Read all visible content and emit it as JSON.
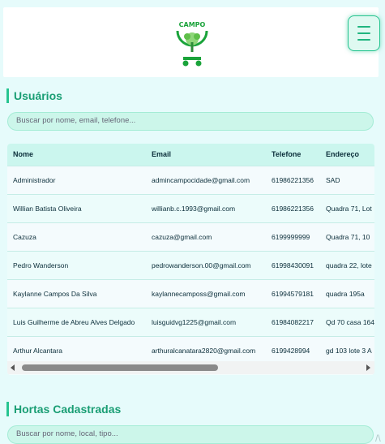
{
  "header": {
    "logo_label": "Campo",
    "menu_icon": "hamburger-icon"
  },
  "users": {
    "title": "Usuários",
    "search_placeholder": "Buscar por nome, email, telefone...",
    "columns": [
      "Nome",
      "Email",
      "Telefone",
      "Endereço"
    ],
    "rows": [
      [
        "Administrador",
        "admincampocidade@gmail.com",
        "61986221356",
        "SAD"
      ],
      [
        "Willian Batista Oliveira",
        "willianb.c.1993@gmail.com",
        "61986221356",
        "Quadra 71, Lot"
      ],
      [
        "Cazuza",
        "cazuza@gmail.com",
        "6199999999",
        "Quadra 71, 10"
      ],
      [
        "Pedro Wanderson",
        "pedrowanderson.00@gmail.com",
        "61998430091",
        "quadra 22, lote"
      ],
      [
        "Kaylanne Campos Da Silva",
        "kaylannecamposs@gmail.com",
        "61994579181",
        "quadra 195a"
      ],
      [
        "Luis Guilherme de Abreu Alves Delgado",
        "luisguidvg1225@gmail.com",
        "61984082217",
        "Qd 70 casa 164"
      ],
      [
        "Arthur Alcantara",
        "arthuralcanatara2820@gmail.com",
        "6199428994",
        "gd 103 lote 3 A"
      ]
    ]
  },
  "hortas": {
    "title": "Hortas Cadastradas",
    "search_placeholder": "Buscar por nome, local, tipo..."
  },
  "colors": {
    "accent": "#27c490",
    "background": "#e6fbfb",
    "title": "#1a9e74"
  }
}
